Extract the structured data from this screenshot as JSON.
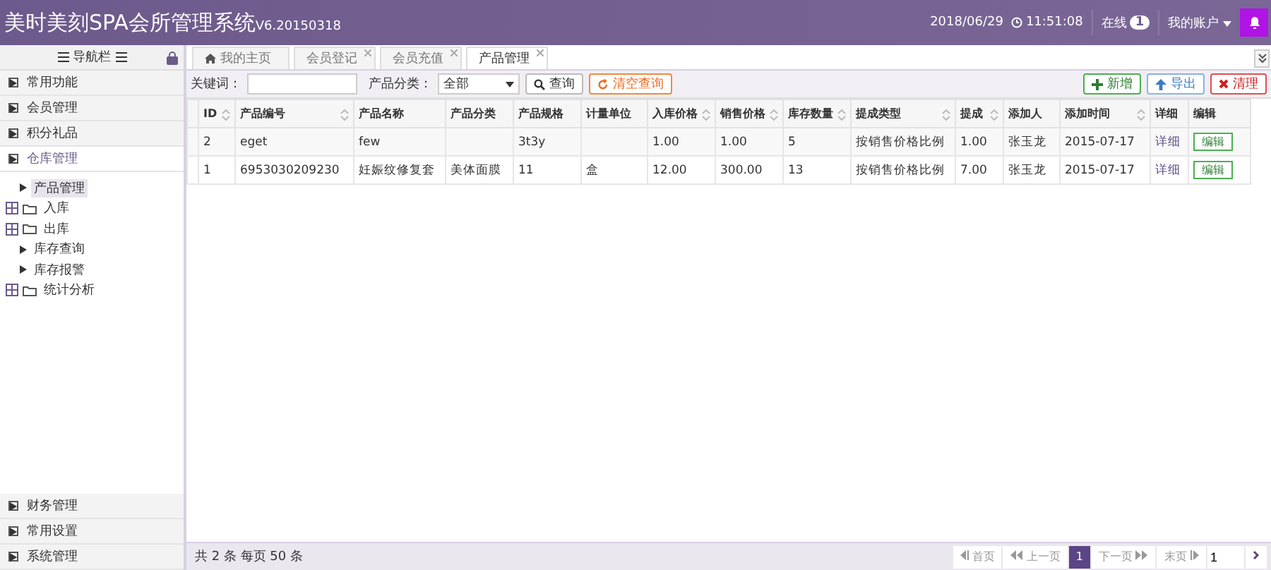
{
  "header": {
    "title": "美时美刻SPA会所管理系统",
    "version": "V6.20150318",
    "datetime": "2018/06/29",
    "time": "11:51:08",
    "online_label": "在线",
    "online_count": "1",
    "account": "我的账户"
  },
  "sidebar": {
    "title": "导航栏",
    "top_items": [
      {
        "label": "常用功能",
        "selected": false
      },
      {
        "label": "会员管理",
        "selected": false
      },
      {
        "label": "积分礼品",
        "selected": false
      },
      {
        "label": "仓库管理",
        "selected": true
      }
    ],
    "tree": [
      {
        "label": "产品管理",
        "kind": "leaf",
        "selected": true
      },
      {
        "label": "入库",
        "kind": "folder",
        "selected": false
      },
      {
        "label": "出库",
        "kind": "folder",
        "selected": false
      },
      {
        "label": "库存查询",
        "kind": "leaf",
        "selected": false
      },
      {
        "label": "库存报警",
        "kind": "leaf",
        "selected": false
      },
      {
        "label": "统计分析",
        "kind": "folder",
        "selected": false
      }
    ],
    "bottom_items": [
      {
        "label": "财务管理",
        "selected": false
      },
      {
        "label": "常用设置",
        "selected": false
      },
      {
        "label": "系统管理",
        "selected": false
      }
    ]
  },
  "tabs": [
    {
      "label": "我的主页",
      "selected": false,
      "closable": false
    },
    {
      "label": "会员登记",
      "selected": false,
      "closable": true
    },
    {
      "label": "会员充值",
      "selected": false,
      "closable": true
    },
    {
      "label": "产品管理",
      "selected": true,
      "closable": true
    }
  ],
  "toolbar": {
    "keyword_label": "关键词：",
    "category_label": "产品分类：",
    "category_value": "全部",
    "search": "查询",
    "clear": "清空查询",
    "add": "新增",
    "export": "导出",
    "purge": "清理"
  },
  "table": {
    "columns": [
      {
        "label": "ID",
        "sortable": true
      },
      {
        "label": "产品编号",
        "sortable": true
      },
      {
        "label": "产品名称",
        "sortable": false
      },
      {
        "label": "产品分类",
        "sortable": false
      },
      {
        "label": "产品规格",
        "sortable": false
      },
      {
        "label": "计量单位",
        "sortable": false
      },
      {
        "label": "入库价格",
        "sortable": true
      },
      {
        "label": "销售价格",
        "sortable": true
      },
      {
        "label": "库存数量",
        "sortable": true
      },
      {
        "label": "提成类型",
        "sortable": true
      },
      {
        "label": "提成",
        "sortable": true
      },
      {
        "label": "添加人",
        "sortable": false
      },
      {
        "label": "添加时间",
        "sortable": true
      },
      {
        "label": "详细",
        "sortable": false
      },
      {
        "label": "编辑",
        "sortable": false
      }
    ],
    "rows": [
      {
        "cells": [
          "2",
          "eget",
          "few",
          "",
          "3t3y",
          "",
          "1.00",
          "1.00",
          "5",
          "按销售价格比例",
          "1.00",
          "张玉龙",
          "2015-07-17"
        ],
        "detail": "详细",
        "edit": "编辑"
      },
      {
        "cells": [
          "1",
          "6953030209230",
          "妊娠纹修复套",
          "美体面膜",
          "11",
          "盒",
          "12.00",
          "300.00",
          "13",
          "按销售价格比例",
          "7.00",
          "张玉龙",
          "2015-07-17"
        ],
        "detail": "详细",
        "edit": "编辑"
      }
    ]
  },
  "footer": {
    "summary": "共 2 条 每页 50 条",
    "first": "首页",
    "prev": "上一页",
    "current": "1",
    "next": "下一页",
    "last": "末页",
    "page_input": "1"
  }
}
